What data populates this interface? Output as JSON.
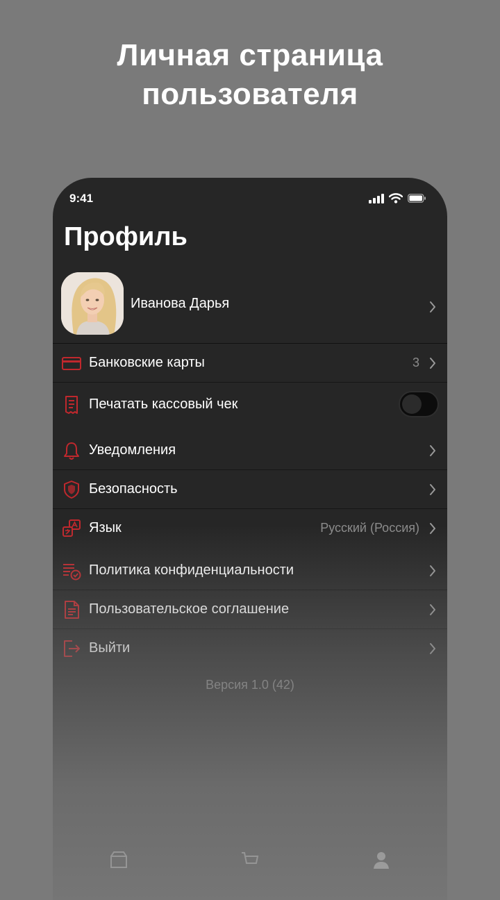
{
  "headline": {
    "line1": "Личная страница",
    "line2": "пользователя"
  },
  "status_bar": {
    "time": "9:41",
    "icons": [
      "signal-icon",
      "wifi-icon",
      "battery-icon"
    ]
  },
  "page": {
    "title": "Профиль"
  },
  "profile": {
    "name": "Иванова Дарья"
  },
  "menu": {
    "bank_cards": {
      "label": "Банковские карты",
      "value": "3",
      "icon": "credit-card-icon"
    },
    "print_receipt": {
      "label": "Печатать кассовый чек",
      "toggle_on": false,
      "icon": "receipt-icon"
    },
    "notifications": {
      "label": "Уведомления",
      "icon": "bell-icon"
    },
    "security": {
      "label": "Безопасность",
      "icon": "shield-icon"
    },
    "language": {
      "label": "Язык",
      "value": "Русский (Россия)",
      "icon": "translate-icon"
    },
    "privacy": {
      "label": "Политика конфиденциальности",
      "icon": "policy-icon"
    },
    "agreement": {
      "label": "Пользовательское соглашение",
      "icon": "document-icon"
    },
    "logout": {
      "label": "Выйти",
      "icon": "logout-icon"
    }
  },
  "version": "Версия 1.0 (42)",
  "colors": {
    "accent": "#c0282d",
    "background": "#7a7a7a",
    "surface": "#262626"
  },
  "tabbar": {
    "icons": [
      "shop-icon",
      "cart-icon",
      "profile-icon"
    ]
  }
}
